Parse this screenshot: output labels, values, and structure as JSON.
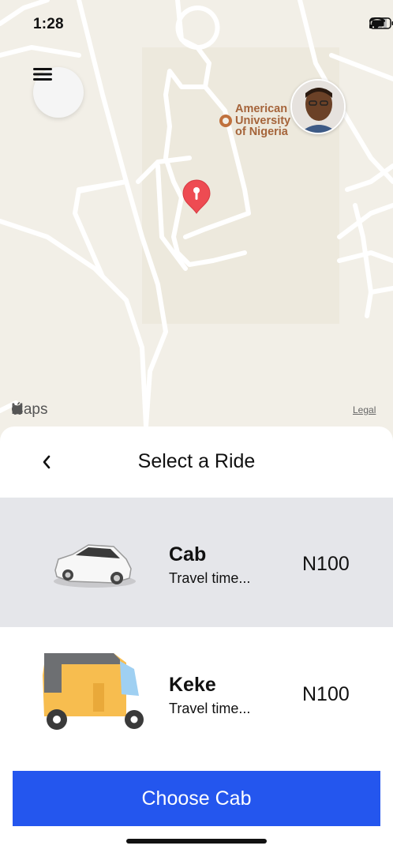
{
  "status_bar": {
    "time": "1:28"
  },
  "map": {
    "poi_label": "American University of Nigeria",
    "attribution": "Maps",
    "legal": "Legal"
  },
  "sheet": {
    "title": "Select a Ride",
    "rides": [
      {
        "name": "Cab",
        "subtitle": "Travel time...",
        "price": "N100",
        "selected": true
      },
      {
        "name": "Keke",
        "subtitle": "Travel time...",
        "price": "N100",
        "selected": false
      }
    ],
    "choose_label": "Choose Cab"
  },
  "colors": {
    "accent": "#2456ee",
    "selected_row": "#e5e6ea",
    "pin": "#ee4b52",
    "poi": "#a5643a"
  },
  "icons": [
    "menu-icon",
    "back-chevron-icon",
    "map-pin-icon",
    "apple-logo-icon",
    "signal-icon",
    "wifi-icon",
    "battery-icon"
  ]
}
